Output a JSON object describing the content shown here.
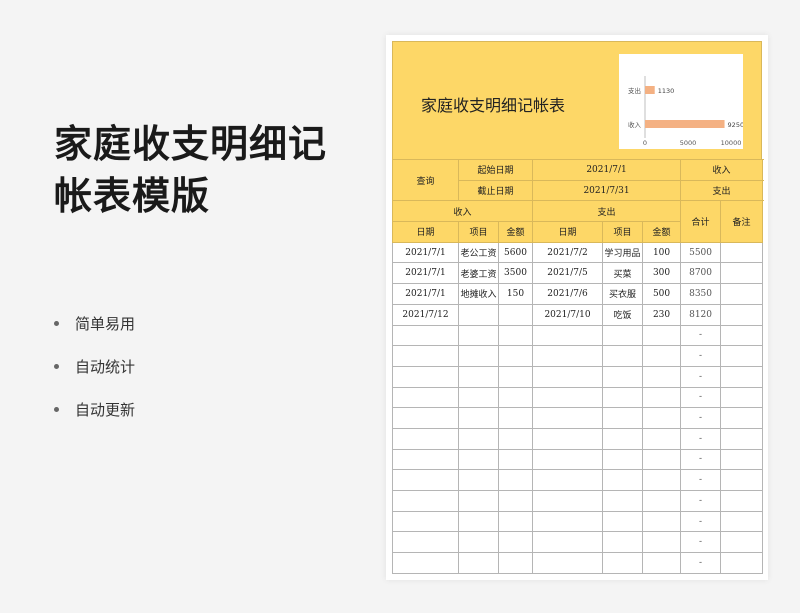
{
  "promo": {
    "title_line1": "家庭收支明细记",
    "title_line2": "帐表模版",
    "features": [
      "简单易用",
      "自动统计",
      "自动更新"
    ]
  },
  "doc": {
    "title": "家庭收支明细记帐表"
  },
  "chart_data": {
    "type": "bar",
    "orientation": "horizontal",
    "categories": [
      "支出",
      "收入"
    ],
    "values": [
      1130,
      9250
    ],
    "data_labels": [
      "1130",
      "9250"
    ],
    "xlim": [
      0,
      10000
    ],
    "xticks": [
      "0",
      "5000",
      "10000"
    ],
    "bar_color": "#f4b183",
    "grid": false
  },
  "summary": {
    "query_label": "查询",
    "start_label": "起始日期",
    "start_value": "2021/7/1",
    "end_label": "截止日期",
    "end_value": "2021/7/31",
    "income_label": "收入",
    "income_total": "9250",
    "expense_label": "支出",
    "expense_total": "1130"
  },
  "headers": {
    "income_group": "收入",
    "expense_group": "支出",
    "total": "合计",
    "note": "备注",
    "date": "日期",
    "item": "项目",
    "amount": "金额"
  },
  "rows": [
    {
      "in_date": "2021/7/1",
      "in_item": "老公工资",
      "in_amount": "5600",
      "ex_date": "2021/7/2",
      "ex_item": "学习用品",
      "ex_amount": "100",
      "total": "5500",
      "note": ""
    },
    {
      "in_date": "2021/7/1",
      "in_item": "老婆工资",
      "in_amount": "3500",
      "ex_date": "2021/7/5",
      "ex_item": "买菜",
      "ex_amount": "300",
      "total": "8700",
      "note": ""
    },
    {
      "in_date": "2021/7/1",
      "in_item": "地摊收入",
      "in_amount": "150",
      "ex_date": "2021/7/6",
      "ex_item": "买衣服",
      "ex_amount": "500",
      "total": "8350",
      "note": ""
    },
    {
      "in_date": "2021/7/12",
      "in_item": "",
      "in_amount": "",
      "ex_date": "2021/7/10",
      "ex_item": "吃饭",
      "ex_amount": "230",
      "total": "8120",
      "note": ""
    },
    {
      "in_date": "",
      "in_item": "",
      "in_amount": "",
      "ex_date": "",
      "ex_item": "",
      "ex_amount": "",
      "total": "-",
      "note": ""
    },
    {
      "in_date": "",
      "in_item": "",
      "in_amount": "",
      "ex_date": "",
      "ex_item": "",
      "ex_amount": "",
      "total": "-",
      "note": ""
    },
    {
      "in_date": "",
      "in_item": "",
      "in_amount": "",
      "ex_date": "",
      "ex_item": "",
      "ex_amount": "",
      "total": "-",
      "note": ""
    },
    {
      "in_date": "",
      "in_item": "",
      "in_amount": "",
      "ex_date": "",
      "ex_item": "",
      "ex_amount": "",
      "total": "-",
      "note": ""
    },
    {
      "in_date": "",
      "in_item": "",
      "in_amount": "",
      "ex_date": "",
      "ex_item": "",
      "ex_amount": "",
      "total": "-",
      "note": ""
    },
    {
      "in_date": "",
      "in_item": "",
      "in_amount": "",
      "ex_date": "",
      "ex_item": "",
      "ex_amount": "",
      "total": "-",
      "note": ""
    },
    {
      "in_date": "",
      "in_item": "",
      "in_amount": "",
      "ex_date": "",
      "ex_item": "",
      "ex_amount": "",
      "total": "-",
      "note": ""
    },
    {
      "in_date": "",
      "in_item": "",
      "in_amount": "",
      "ex_date": "",
      "ex_item": "",
      "ex_amount": "",
      "total": "-",
      "note": ""
    },
    {
      "in_date": "",
      "in_item": "",
      "in_amount": "",
      "ex_date": "",
      "ex_item": "",
      "ex_amount": "",
      "total": "-",
      "note": ""
    },
    {
      "in_date": "",
      "in_item": "",
      "in_amount": "",
      "ex_date": "",
      "ex_item": "",
      "ex_amount": "",
      "total": "-",
      "note": ""
    },
    {
      "in_date": "",
      "in_item": "",
      "in_amount": "",
      "ex_date": "",
      "ex_item": "",
      "ex_amount": "",
      "total": "-",
      "note": ""
    },
    {
      "in_date": "",
      "in_item": "",
      "in_amount": "",
      "ex_date": "",
      "ex_item": "",
      "ex_amount": "",
      "total": "-",
      "note": ""
    }
  ]
}
